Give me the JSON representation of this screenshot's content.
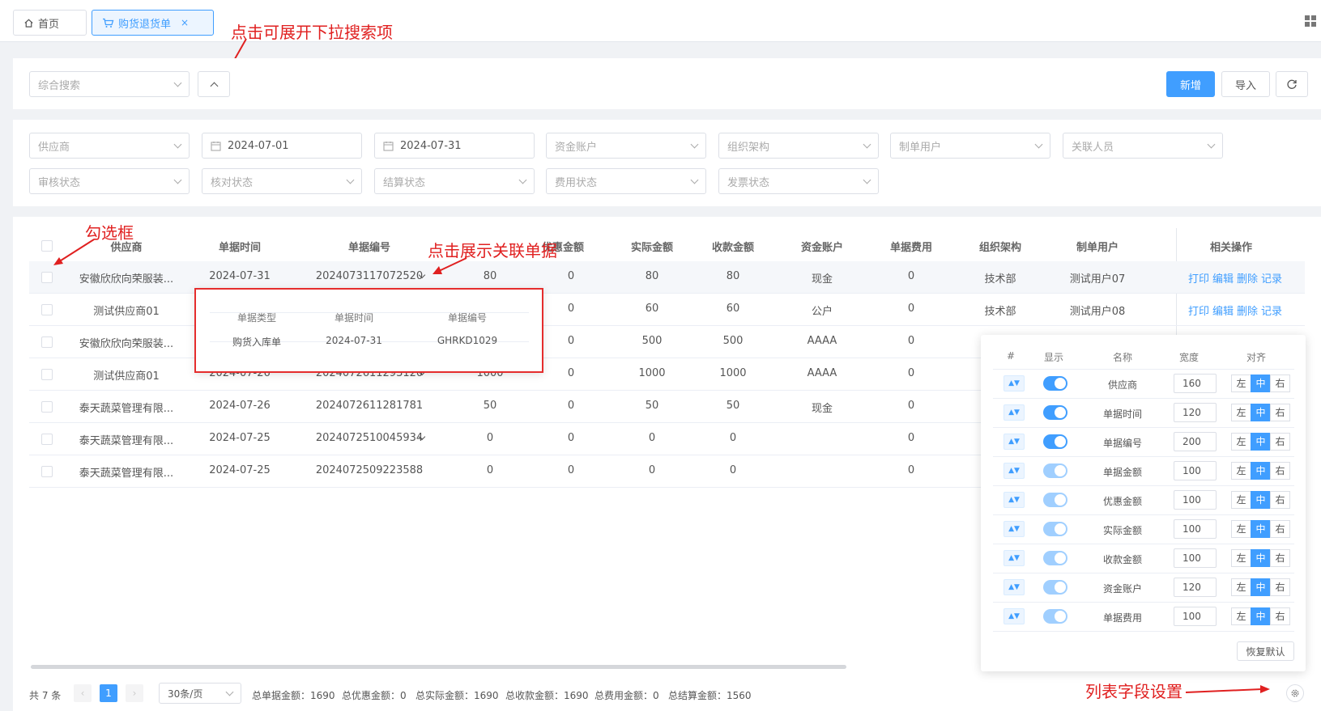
{
  "tabs": {
    "home": "首页",
    "current": "购货退货单",
    "close": "×"
  },
  "annotations": {
    "expand": "点击可展开下拉搜索项",
    "checkbox": "勾选框",
    "related": "点击展示关联单据",
    "column_settings": "列表字段设置"
  },
  "toolbar": {
    "search_placeholder": "综合搜索",
    "add": "新增",
    "import": "导入"
  },
  "filters": {
    "supplier": "供应商",
    "date_start": "2024-07-01",
    "date_end": "2024-07-31",
    "account": "资金账户",
    "org": "组织架构",
    "creator": "制单用户",
    "related_person": "关联人员",
    "audit": "审核状态",
    "check": "核对状态",
    "settle": "结算状态",
    "fee": "费用状态",
    "invoice": "发票状态"
  },
  "columns": [
    "供应商",
    "单据时间",
    "单据编号",
    "单据金额",
    "优惠金额",
    "实际金额",
    "收款金额",
    "资金账户",
    "单据费用",
    "组织架构",
    "制单用户",
    "相关操作"
  ],
  "rows": [
    {
      "supplier": "安徽欣欣向荣服装...",
      "date": "2024-07-31",
      "no": "2024073117072520",
      "has_related": true,
      "amount": "80",
      "discount": "0",
      "actual": "80",
      "received": "80",
      "account": "现金",
      "fee": "0",
      "org": "技术部",
      "creator": "测试用户07"
    },
    {
      "supplier": "测试供应商01",
      "date": "",
      "no": "",
      "has_related": false,
      "amount": "",
      "discount": "0",
      "actual": "60",
      "received": "60",
      "account": "公户",
      "fee": "0",
      "org": "技术部",
      "creator": "测试用户08"
    },
    {
      "supplier": "安徽欣欣向荣服装...",
      "date": "",
      "no": "",
      "has_related": false,
      "amount": "",
      "discount": "0",
      "actual": "500",
      "received": "500",
      "account": "AAAA",
      "fee": "0",
      "org": "",
      "creator": ""
    },
    {
      "supplier": "测试供应商01",
      "date": "2024-07-26",
      "no": "2024072611293120",
      "has_related": true,
      "amount": "1000",
      "discount": "0",
      "actual": "1000",
      "received": "1000",
      "account": "AAAA",
      "fee": "0",
      "org": "",
      "creator": ""
    },
    {
      "supplier": "泰天蔬菜管理有限...",
      "date": "2024-07-26",
      "no": "2024072611281781",
      "has_related": false,
      "amount": "50",
      "discount": "0",
      "actual": "50",
      "received": "50",
      "account": "现金",
      "fee": "0",
      "org": "",
      "creator": ""
    },
    {
      "supplier": "泰天蔬菜管理有限...",
      "date": "2024-07-25",
      "no": "2024072510045934",
      "has_related": true,
      "amount": "0",
      "discount": "0",
      "actual": "0",
      "received": "0",
      "account": "",
      "fee": "0",
      "org": "",
      "creator": ""
    },
    {
      "supplier": "泰天蔬菜管理有限...",
      "date": "2024-07-25",
      "no": "2024072509223588",
      "has_related": false,
      "amount": "0",
      "discount": "0",
      "actual": "0",
      "received": "0",
      "account": "",
      "fee": "0",
      "org": "",
      "creator": ""
    }
  ],
  "row_ops": [
    "打印",
    "编辑",
    "删除",
    "记录"
  ],
  "related_popup": {
    "headers": [
      "单据类型",
      "单据时间",
      "单据编号"
    ],
    "row": [
      "购货入库单",
      "2024-07-31",
      "GHRKD1029"
    ]
  },
  "column_settings": {
    "headers": [
      "#",
      "显示",
      "名称",
      "宽度",
      "对齐"
    ],
    "align_labels": [
      "左",
      "中",
      "右"
    ],
    "reset": "恢复默认",
    "rows": [
      {
        "name": "供应商",
        "width": "160",
        "show": true
      },
      {
        "name": "单据时间",
        "width": "120",
        "show": true
      },
      {
        "name": "单据编号",
        "width": "200",
        "show": true
      },
      {
        "name": "单据金额",
        "width": "100",
        "show": true
      },
      {
        "name": "优惠金额",
        "width": "100",
        "show": true
      },
      {
        "name": "实际金额",
        "width": "100",
        "show": true
      },
      {
        "name": "收款金额",
        "width": "100",
        "show": true
      },
      {
        "name": "资金账户",
        "width": "120",
        "show": true
      },
      {
        "name": "单据费用",
        "width": "100",
        "show": true
      }
    ]
  },
  "footer": {
    "total": "共 7 条",
    "page": "1",
    "page_size": "30条/页",
    "sums": [
      "总单据金额：1690",
      "总优惠金额：0",
      "总实际金额：1690",
      "总收款金额：1690",
      "总费用金额：0",
      "总结算金额：1560"
    ]
  },
  "colors": {
    "primary": "#409eff",
    "annotation": "#e02020"
  }
}
